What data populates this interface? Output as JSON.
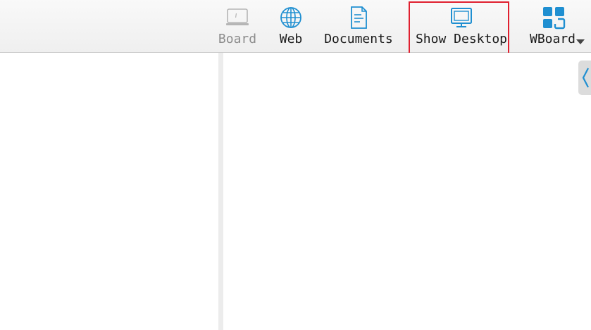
{
  "toolbar": {
    "board_label": "Board",
    "web_label": "Web",
    "documents_label": "Documents",
    "show_desktop_label": "Show Desktop",
    "wboard_label": "WBoard"
  },
  "icons": {
    "board": "board-icon",
    "web": "globe-icon",
    "documents": "document-icon",
    "show_desktop": "monitor-icon",
    "wboard": "apps-grid-icon",
    "dropdown": "chevron-down-icon",
    "collapse": "chevron-left-icon"
  },
  "colors": {
    "accent": "#1f8fd1",
    "highlight_border": "#e0202f",
    "disabled_text": "#8c8c8c"
  }
}
